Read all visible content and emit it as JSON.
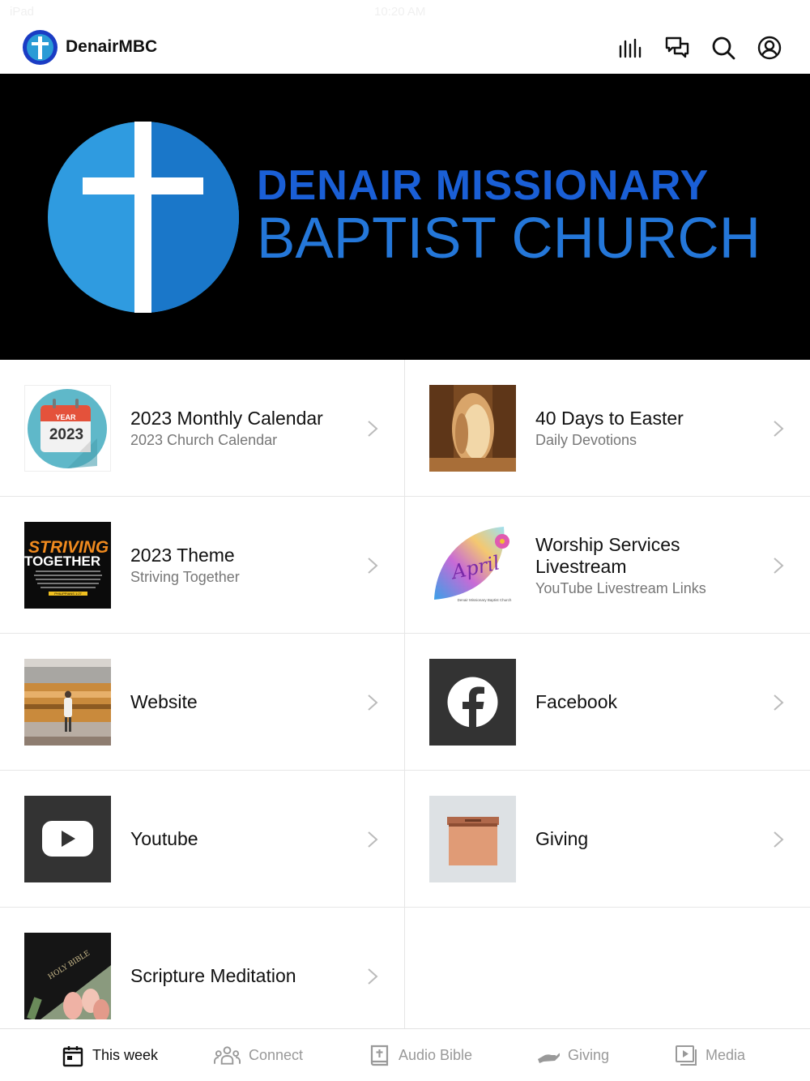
{
  "status_bar": {
    "left": "iPad",
    "time": "10:20 AM"
  },
  "header": {
    "title": "DenairMBC",
    "icons": [
      "bars-chart-icon",
      "chat-icon",
      "search-icon",
      "profile-icon"
    ]
  },
  "banner": {
    "line1": "DENAIR MISSIONARY",
    "line2": "BAPTIST CHURCH",
    "colors": {
      "circle": "#2f9be0",
      "text": "#1a5fd6",
      "background": "#000000"
    }
  },
  "tiles": [
    {
      "title": "2023 Monthly Calendar",
      "subtitle": "2023 Church Calendar",
      "thumb": "calendar-2023",
      "thumb_text_year": "YEAR",
      "thumb_text_num": "2023"
    },
    {
      "title": "40 Days to Easter",
      "subtitle": "Daily Devotions",
      "thumb": "empty-tomb"
    },
    {
      "title": "2023 Theme",
      "subtitle": "Striving Together",
      "thumb": "striving-together",
      "thumb_text_1": "STRIVING",
      "thumb_text_2": "TOGETHER",
      "thumb_text_3": "PHILIPPIANS 1:27"
    },
    {
      "title": "Worship Services Livestream",
      "subtitle": "YouTube Livestream Links",
      "thumb": "april-leaf",
      "thumb_text_1": "April",
      "thumb_text_2": "Denair Missionary Baptist Church"
    },
    {
      "title": "Website",
      "subtitle": "",
      "thumb": "train-station"
    },
    {
      "title": "Facebook",
      "subtitle": "",
      "thumb": "facebook"
    },
    {
      "title": "Youtube",
      "subtitle": "",
      "thumb": "youtube"
    },
    {
      "title": "Giving",
      "subtitle": "",
      "thumb": "offering-box"
    },
    {
      "title": "Scripture Meditation",
      "subtitle": "",
      "thumb": "holy-bible",
      "thumb_text_1": "HOLY BIBLE"
    }
  ],
  "tabs": [
    {
      "label": "This week",
      "icon": "calendar-icon",
      "active": true
    },
    {
      "label": "Connect",
      "icon": "people-icon",
      "active": false
    },
    {
      "label": "Audio Bible",
      "icon": "bible-icon",
      "active": false
    },
    {
      "label": "Giving",
      "icon": "giving-hand-icon",
      "active": false
    },
    {
      "label": "Media",
      "icon": "media-icon",
      "active": false
    }
  ]
}
